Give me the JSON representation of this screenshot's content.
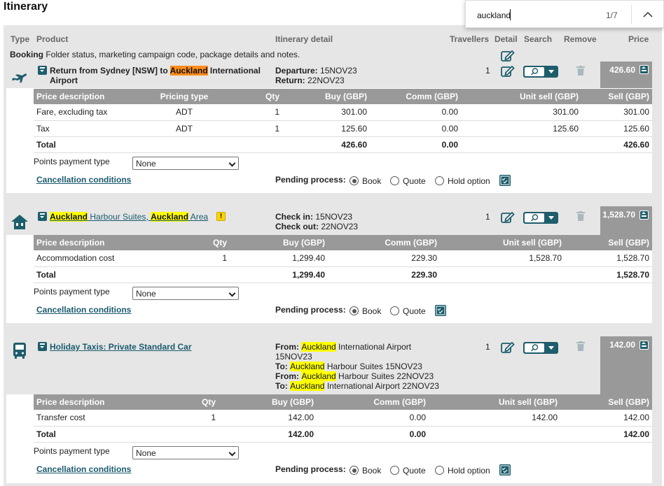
{
  "page_title": "Itinerary",
  "findbar": {
    "query": "auckland",
    "count": "1/7"
  },
  "header": {
    "type": "Type",
    "product": "Product",
    "itinerary_detail": "Itinerary detail",
    "travellers": "Travellers",
    "detail": "Detail",
    "search": "Search",
    "remove": "Remove",
    "price": "Price"
  },
  "booking": {
    "label_bold": "Booking",
    "label_rest": " Folder status, marketing campaign code, package details and notes."
  },
  "points_label": "Points payment type",
  "points_value": "None",
  "cancellation_label": "Cancellation conditions",
  "pending_label": "Pending process:",
  "radio_book": "Book",
  "radio_quote": "Quote",
  "radio_hold": "Hold option",
  "items": [
    {
      "type_icon": "plane-icon",
      "title_a": "Return from Sydney [NSW] to ",
      "title_hl": "Auckland",
      "title_b": " International",
      "title_line2": "Airport",
      "detail_l1_label": "Departure:",
      "detail_l1_value": " 15NOV23",
      "detail_l2_label": "Return:",
      "detail_l2_value": " 22NOV23",
      "travellers": "1",
      "price": "426.60",
      "columns": [
        "Price description",
        "Pricing type",
        "Qty",
        "Buy (GBP)",
        "Comm (GBP)",
        "Unit sell (GBP)",
        "Sell (GBP)"
      ],
      "rows": [
        [
          "Fare, excluding tax",
          "ADT",
          "1",
          "301.00",
          "0.00",
          "301.00",
          "301.00"
        ],
        [
          "Tax",
          "ADT",
          "1",
          "125.60",
          "0.00",
          "125.60",
          "125.60"
        ]
      ],
      "total": [
        "Total",
        "",
        "",
        "426.60",
        "0.00",
        "",
        "426.60"
      ]
    },
    {
      "type_icon": "house-icon",
      "title_hl1": "Auckland",
      "title_mid": " Harbour Suites, ",
      "title_hl2": "Auckland",
      "title_end": " Area",
      "warning": "!",
      "detail_l1_label": "Check in:",
      "detail_l1_value": " 15NOV23",
      "detail_l2_label": "Check out:",
      "detail_l2_value": " 22NOV23",
      "travellers": "1",
      "price": "1,528.70",
      "columns": [
        "Price description",
        "Qty",
        "Buy (GBP)",
        "Comm (GBP)",
        "Unit sell (GBP)",
        "Sell (GBP)"
      ],
      "rows": [
        [
          "Accommodation cost",
          "1",
          "1,299.40",
          "229.30",
          "1,528.70",
          "1,528.70"
        ]
      ],
      "total": [
        "Total",
        "",
        "1,299.40",
        "229.30",
        "",
        "1,528.70"
      ]
    },
    {
      "type_icon": "bus-icon",
      "title": "Holiday Taxis: Private Standard Car",
      "d1_label": "From:",
      "d1_hl": "Auckland",
      "d1_rest": " International Airport",
      "d1b": "15NOV23",
      "d2_label": "To:",
      "d2_hl": "Auckland",
      "d2_rest": " Harbour Suites 15NOV23",
      "d3_label": "From:",
      "d3_hl": "Auckland",
      "d3_rest": " Harbour Suites 22NOV23",
      "d4_label": "To:",
      "d4_hl": "Auckland",
      "d4_rest": " International Airport 22NOV23",
      "travellers": "1",
      "price": "142.00",
      "columns": [
        "Price description",
        "Qty",
        "Buy (GBP)",
        "Comm (GBP)",
        "Unit sell (GBP)",
        "Sell (GBP)"
      ],
      "rows": [
        [
          "Transfer cost",
          "1",
          "142.00",
          "0.00",
          "142.00",
          "142.00"
        ]
      ],
      "total": [
        "Total",
        "",
        "142.00",
        "0.00",
        "",
        "142.00"
      ]
    }
  ]
}
